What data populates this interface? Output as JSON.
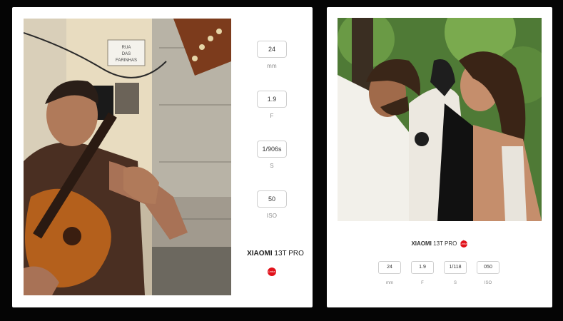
{
  "left_card": {
    "exif": [
      {
        "value": "24",
        "unit": "mm"
      },
      {
        "value": "1.9",
        "unit": "F"
      },
      {
        "value": "1/906s",
        "unit": "S"
      },
      {
        "value": "50",
        "unit": "ISO"
      }
    ],
    "brand_name": "XIAOMI",
    "model": "13T PRO",
    "sign_text_1": "RUA",
    "sign_text_2": "DAS",
    "sign_text_3": "FARINHAS"
  },
  "right_card": {
    "brand_name": "XIAOMI",
    "model": "13T PRO",
    "exif": [
      {
        "value": "24",
        "unit": "mm"
      },
      {
        "value": "1.9",
        "unit": "F"
      },
      {
        "value": "1/118",
        "unit": "S"
      },
      {
        "value": "050",
        "unit": "ISO"
      }
    ]
  },
  "logo_text": "Leica",
  "colors": {
    "background": "#050505",
    "card": "#ffffff",
    "leica_red": "#e1111a"
  }
}
